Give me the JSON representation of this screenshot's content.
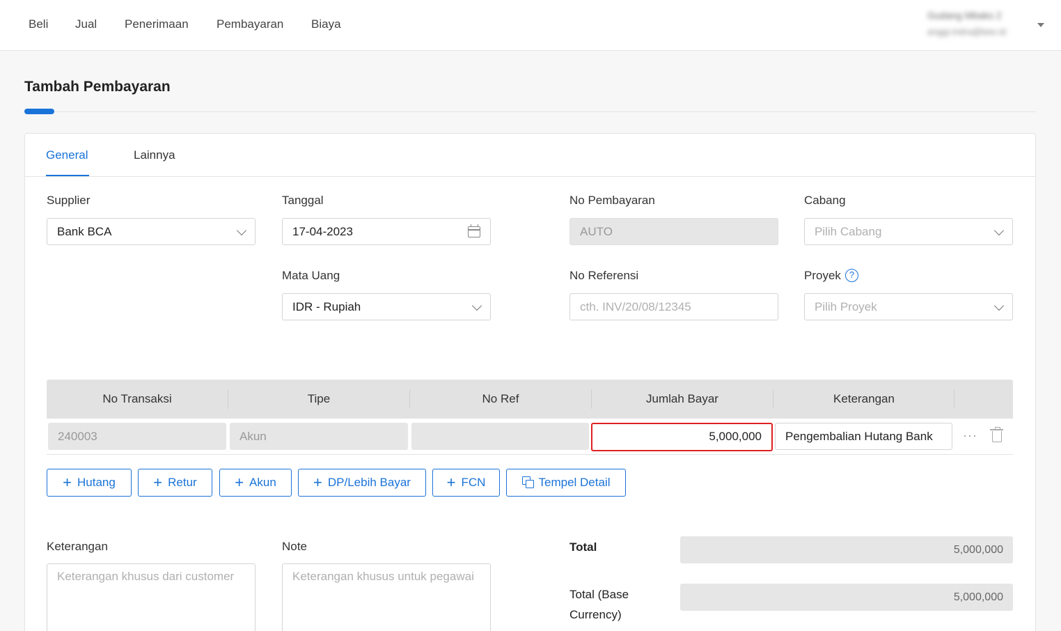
{
  "nav": {
    "items": [
      {
        "label": "Beli"
      },
      {
        "label": "Jual"
      },
      {
        "label": "Penerimaan"
      },
      {
        "label": "Pembayaran"
      },
      {
        "label": "Biaya"
      }
    ]
  },
  "user": {
    "name": "Gudang Mbaks 2",
    "email": "anggi.indra@bee.id"
  },
  "page": {
    "title": "Tambah Pembayaran"
  },
  "tabs": [
    {
      "label": "General"
    },
    {
      "label": "Lainnya"
    }
  ],
  "form": {
    "supplier": {
      "label": "Supplier",
      "value": "Bank BCA"
    },
    "tanggal": {
      "label": "Tanggal",
      "value": "17-04-2023"
    },
    "no_pembayaran": {
      "label": "No Pembayaran",
      "value": "AUTO"
    },
    "cabang": {
      "label": "Cabang",
      "placeholder": "Pilih Cabang"
    },
    "mata_uang": {
      "label": "Mata Uang",
      "value": "IDR - Rupiah"
    },
    "no_referensi": {
      "label": "No Referensi",
      "placeholder": "cth. INV/20/08/12345"
    },
    "proyek": {
      "label": "Proyek",
      "placeholder": "Pilih Proyek"
    }
  },
  "table": {
    "columns": [
      "No Transaksi",
      "Tipe",
      "No Ref",
      "Jumlah Bayar",
      "Keterangan"
    ],
    "rows": [
      {
        "no_transaksi": "240003",
        "tipe": "Akun",
        "no_ref": "",
        "jumlah_bayar": "5,000,000",
        "keterangan": "Pengembalian Hutang Bank"
      }
    ]
  },
  "actions": {
    "hutang": "Hutang",
    "retur": "Retur",
    "akun": "Akun",
    "dp": "DP/Lebih Bayar",
    "fcn": "FCN",
    "tempel": "Tempel Detail"
  },
  "notes": {
    "keterangan_label": "Keterangan",
    "keterangan_placeholder": "Keterangan khusus dari customer",
    "note_label": "Note",
    "note_placeholder": "Keterangan khusus untuk pegawai"
  },
  "totals": {
    "total_label": "Total",
    "total_value": "5,000,000",
    "base_label": "Total (Base Currency)",
    "base_value": "5,000,000"
  }
}
